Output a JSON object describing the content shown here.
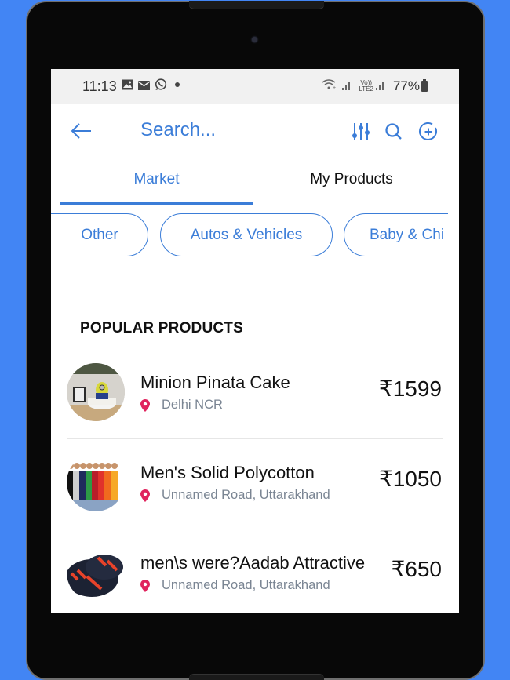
{
  "status_bar": {
    "time": "11:13",
    "notification_icons": [
      "gallery-icon",
      "email-icon",
      "whatsapp-icon",
      "dot-icon"
    ],
    "network": {
      "wifi": "wifi-calling-icon",
      "volte_label_top": "Vo))",
      "volte_label_bottom": "LTE2"
    },
    "battery_percent": "77%"
  },
  "app_bar": {
    "back_icon": "arrow-left-icon",
    "search_placeholder": "Search...",
    "actions": [
      "filter-sliders-icon",
      "search-icon",
      "add-circle-icon"
    ]
  },
  "tabs": [
    {
      "label": "Market",
      "active": true
    },
    {
      "label": "My Products",
      "active": false
    }
  ],
  "categories": [
    {
      "label": "Other"
    },
    {
      "label": "Autos & Vehicles"
    },
    {
      "label": "Baby & Chi"
    }
  ],
  "section_title": "POPULAR PRODUCTS",
  "products": [
    {
      "title": "Minion Pinata Cake",
      "location": "Delhi NCR",
      "price": "₹1599",
      "image": "cake-photo"
    },
    {
      "title": "Men's Solid Polycotton",
      "location": "Unnamed Road, Uttarakhand",
      "price": "₹1050",
      "image": "tshirts-photo"
    },
    {
      "title": "men\\s were?Aadab Attractive",
      "location": "Unnamed Road, Uttarakhand",
      "price": "₹650",
      "image": "shoes-photo"
    }
  ],
  "colors": {
    "accent": "#3b7dd8",
    "background_outer": "#4285f4",
    "location_pin": "#e0245e",
    "location_text": "#7a8593",
    "status_bar_bg": "#f1f1f1"
  }
}
